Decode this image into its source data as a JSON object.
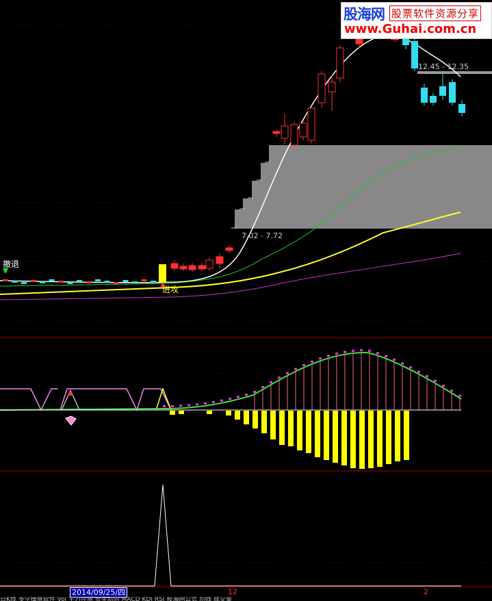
{
  "watermark": {
    "site_name": "股海网",
    "slogan": "股票软件资源分享",
    "url": "www.Guhai.com.cn"
  },
  "main_chart": {
    "price_range_high": "12.45 - 12.35",
    "price_range_low": "7.02 - 7.72",
    "signal_retreat": "撤退",
    "signal_attack": "进攻"
  },
  "time_axis": {
    "selected_date": "2014/09/25/四",
    "month_labels": [
      "12",
      "2"
    ]
  },
  "status_bar": {
    "text": "日K线 多空操盘软件 Vol 主力控盘 资金动向 MACD KDJ RSI 股海网公式 均线 成交量"
  },
  "colors": {
    "background": "#000000",
    "up_candle": "#ff3030",
    "down_candle": "#33ddee",
    "ma_white": "#ffffff",
    "ma_green": "#22cc22",
    "ma_yellow": "#ffff33",
    "ma_magenta": "#cc33cc",
    "grid_line": "#aa0000",
    "volume_block": "#888888"
  }
}
